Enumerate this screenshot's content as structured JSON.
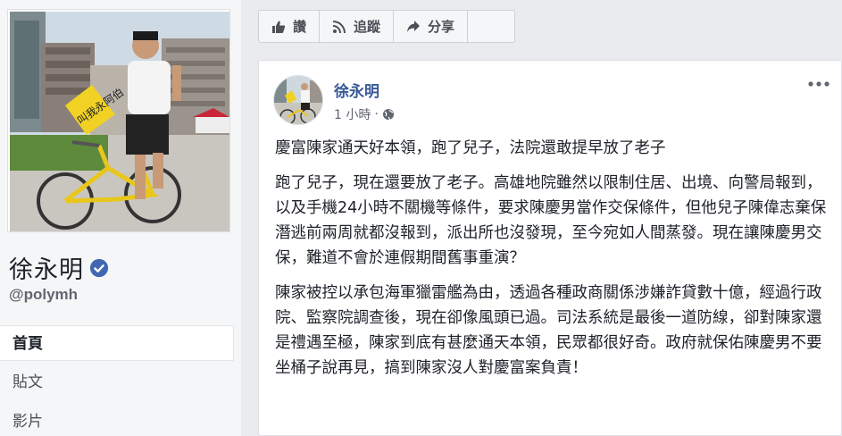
{
  "page": {
    "name": "徐永明",
    "handle": "@polymh",
    "verified": true
  },
  "profile_photo": {
    "sign_text": "叫我永阿伯"
  },
  "nav": {
    "items": [
      {
        "label": "首頁",
        "active": true
      },
      {
        "label": "貼文",
        "active": false
      },
      {
        "label": "影片",
        "active": false
      }
    ]
  },
  "actions": {
    "like_label": "讚",
    "follow_label": "追蹤",
    "share_label": "分享"
  },
  "post": {
    "author": "徐永明",
    "time": "1 小時",
    "paragraphs": [
      "慶富陳家通天好本領，跑了兒子，法院還敢提早放了老子",
      "跑了兒子，現在還要放了老子。高雄地院雖然以限制住居、出境、向警局報到，以及手機24小時不關機等條件，要求陳慶男當作交保條件，但他兒子陳偉志棄保潛逃前兩周就都沒報到，派出所也沒發現，至今宛如人間蒸發。現在讓陳慶男交保，難道不會於連假期間舊事重演？",
      "陳家被控以承包海軍獵雷艦為由，透過各種政商關係涉嫌詐貸數十億，經過行政院、監察院調查後，現在卻像風頭已過。司法系統是最後一道防線，卻對陳家還是禮遇至極，陳家到底有甚麼通天本領，民眾都很好奇。政府就保佑陳慶男不要坐桶子說再見，搞到陳家沒人對慶富案負責！"
    ]
  },
  "colors": {
    "link": "#385898",
    "verified": "#4267b2",
    "bike": "#e8c61c"
  },
  "icons": [
    "verified-icon",
    "thumbs-up-icon",
    "rss-icon",
    "share-arrow-icon",
    "more-dots-icon",
    "globe-icon"
  ]
}
